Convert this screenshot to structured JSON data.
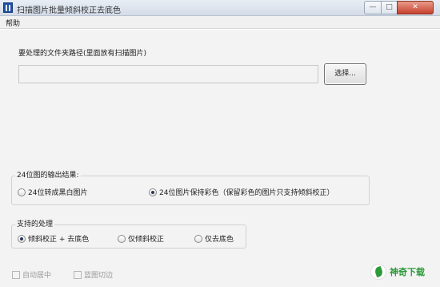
{
  "window": {
    "title": "扫描图片批量倾斜校正去底色",
    "min_label": "—",
    "max_label": "□",
    "close_label": "✕"
  },
  "menu": {
    "items": [
      "帮助"
    ]
  },
  "folder": {
    "label": "要处理的文件夹路径(里面放有扫描图片)",
    "path_value": "",
    "choose_label": "选择..."
  },
  "output_group": {
    "title": "24位图的输出结果:",
    "options": [
      {
        "label": "24位转成黑白图片",
        "selected": false
      },
      {
        "label": "24位图片保持彩色（保留彩色的图片只支持倾斜校正）",
        "selected": true
      }
    ]
  },
  "process_group": {
    "title": "支持的处理",
    "options": [
      {
        "label": "倾斜校正 + 去底色",
        "selected": true
      },
      {
        "label": "仅倾斜校正",
        "selected": false
      },
      {
        "label": "仅去底色",
        "selected": false
      }
    ]
  },
  "checkboxes": [
    {
      "label": "自动居中",
      "checked": false,
      "enabled": false
    },
    {
      "label": "蓝图切边",
      "checked": false,
      "enabled": false
    }
  ],
  "watermark": {
    "text": "神奇下载"
  }
}
